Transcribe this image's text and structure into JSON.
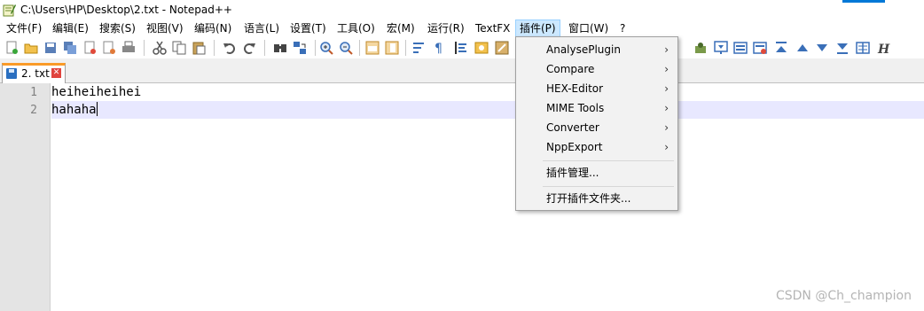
{
  "window": {
    "title": "C:\\Users\\HP\\Desktop\\2.txt - Notepad++"
  },
  "menubar": {
    "items": [
      {
        "label": "文件(F)"
      },
      {
        "label": "编辑(E)"
      },
      {
        "label": "搜索(S)"
      },
      {
        "label": "视图(V)"
      },
      {
        "label": "编码(N)"
      },
      {
        "label": "语言(L)"
      },
      {
        "label": "设置(T)"
      },
      {
        "label": "工具(O)"
      },
      {
        "label": "宏(M)"
      },
      {
        "label": "运行(R)"
      },
      {
        "label": "TextFX"
      },
      {
        "label": "插件(P)"
      },
      {
        "label": "窗口(W)"
      },
      {
        "label": "?"
      }
    ],
    "active": "插件(P)"
  },
  "tab": {
    "label": "2. txt"
  },
  "editor": {
    "lines": [
      {
        "number": "1",
        "text": "heiheiheihei"
      },
      {
        "number": "2",
        "text": "hahaha"
      }
    ]
  },
  "plugins_menu": {
    "items": [
      {
        "label": "AnalysePlugin",
        "submenu": true
      },
      {
        "label": "Compare",
        "submenu": true
      },
      {
        "label": "HEX-Editor",
        "submenu": true
      },
      {
        "label": "MIME Tools",
        "submenu": true
      },
      {
        "label": "Converter",
        "submenu": true
      },
      {
        "label": "NppExport",
        "submenu": true
      },
      {
        "label": "插件管理...",
        "submenu": false
      },
      {
        "label": "打开插件文件夹...",
        "submenu": false
      }
    ]
  },
  "watermark": "CSDN @Ch_champion",
  "colors": {
    "menu_highlight": "#cce8ff",
    "tab_accent": "#fa9a28",
    "current_line": "#e8e8ff"
  }
}
